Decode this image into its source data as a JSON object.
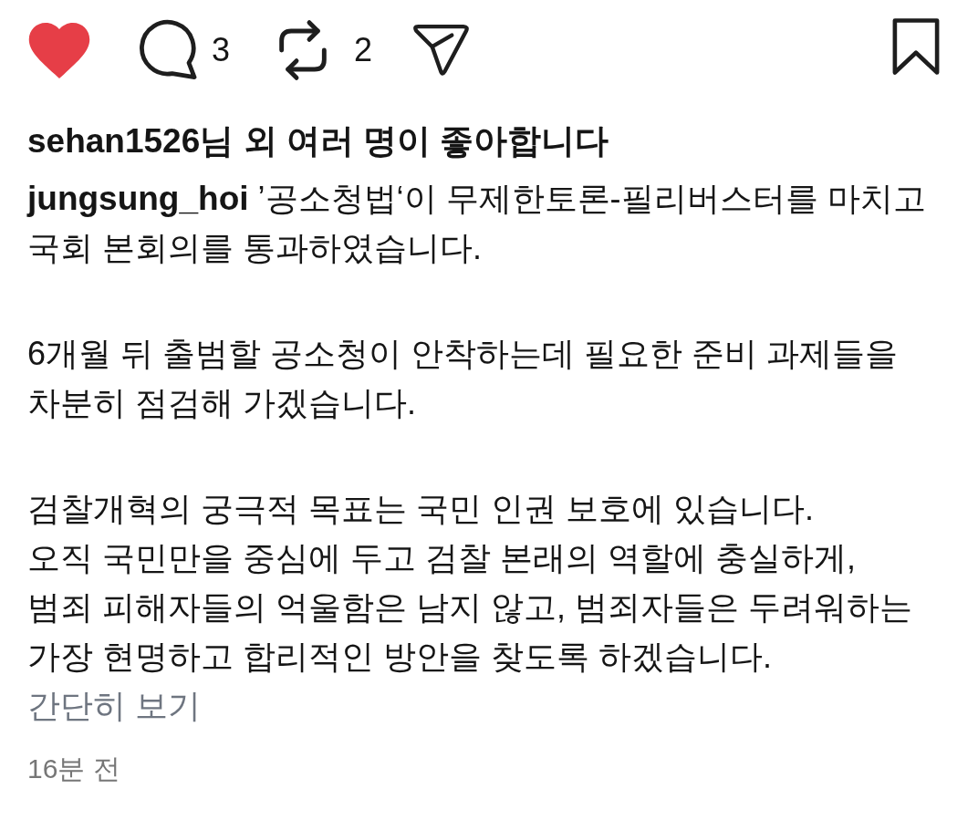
{
  "actions": {
    "liked": true,
    "comment_count": "3",
    "repost_count": "2",
    "saved": false
  },
  "likes_summary": "sehan1526님 외 여러 명이 좋아합니다",
  "caption": {
    "username": "jungsung_hoi",
    "paragraphs": [
      "’공소청법‘이 무제한토론-필리버스터를 마치고\n국회 본회의를 통과하였습니다.",
      "6개월 뒤 출범할 공소청이 안착하는데 필요한 준비 과제들을\n차분히 점검해 가겠습니다.",
      "검찰개혁의 궁극적 목표는 국민 인권 보호에 있습니다.\n오직 국민만을 중심에 두고 검찰 본래의 역할에 충실하게,\n범죄 피해자들의 억울함은 남지 않고, 범죄자들은 두려워하는\n가장 현명하고 합리적인 방안을 찾도록 하겠습니다."
    ],
    "collapse_link": "간단히 보기"
  },
  "timestamp": "16분 전"
}
